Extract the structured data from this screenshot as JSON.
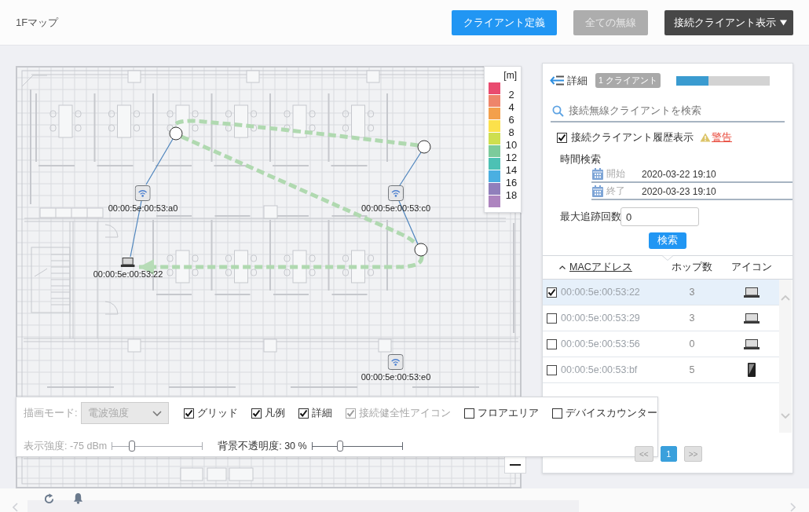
{
  "header": {
    "title": "1Fマップ",
    "buttons": [
      {
        "label": "クライアント定義",
        "kind": "primary",
        "disabled": false
      },
      {
        "label": "全ての無線",
        "kind": "plain",
        "disabled": true
      },
      {
        "label": "接続クライアント表示",
        "kind": "dropdown",
        "disabled": false
      }
    ]
  },
  "map": {
    "legend": {
      "unit": "[m]",
      "swatches": [
        {
          "color": "#e94b6f"
        },
        {
          "color": "#ee856a"
        },
        {
          "color": "#f3a04c"
        },
        {
          "color": "#fce14b"
        },
        {
          "color": "#cedf4f"
        },
        {
          "color": "#7ccb9b"
        },
        {
          "color": "#4dc1b4"
        },
        {
          "color": "#4bafe1"
        },
        {
          "color": "#907fbb"
        },
        {
          "color": "#ad84bf"
        }
      ],
      "labels": [
        "2",
        "4",
        "6",
        "8",
        "10",
        "12",
        "14",
        "16",
        "18"
      ]
    },
    "access_points": [
      {
        "label": "00:00:5e:00:53:a0"
      },
      {
        "label": "00:00:5e:00:53:c0"
      },
      {
        "label": "00:00:5e:00:53:e0"
      }
    ],
    "clients": [
      {
        "label": "00:00:5e:00:53:22",
        "kind": "laptop"
      }
    ]
  },
  "details": {
    "title": "詳細",
    "badge": "1 クライアント",
    "progress": {
      "level": 0.35
    },
    "search": {
      "placeholder": "接続無線クライアントを検索"
    },
    "history": {
      "label": "接続クライアント履歴表示",
      "checked": true,
      "warning": "警告"
    },
    "time_search": {
      "label": "時間検索",
      "fields": [
        {
          "label": "開始",
          "value": "2020-03-22 19:10"
        },
        {
          "label": "終了",
          "value": "2020-03-23 19:10"
        }
      ]
    },
    "max_trace": {
      "label": "最大追跡回数",
      "value": "0"
    },
    "search_button": "検索",
    "table": {
      "columns": [
        {
          "label": "MACアドレス",
          "sorted": true
        },
        {
          "label": "ホップ数",
          "sorted": false
        },
        {
          "label": "アイコン",
          "sorted": false
        }
      ],
      "rows": [
        {
          "checked": true,
          "selected": true,
          "mac": "00:00:5e:00:53:22",
          "hops": "3",
          "kind": "laptop"
        },
        {
          "checked": false,
          "selected": false,
          "mac": "00:00:5e:00:53:29",
          "hops": "3",
          "kind": "laptop"
        },
        {
          "checked": false,
          "selected": false,
          "mac": "00:00:5e:00:53:56",
          "hops": "0",
          "kind": "laptop"
        },
        {
          "checked": false,
          "selected": false,
          "mac": "00:00:5e:00:53:bf",
          "hops": "5",
          "kind": "phone"
        }
      ]
    },
    "pagination": {
      "prev": {
        "label": "<<",
        "disabled": true
      },
      "pages": [
        {
          "label": "1",
          "selected": true
        }
      ],
      "next": {
        "label": ">>",
        "disabled": true
      }
    }
  },
  "controls": {
    "mode": {
      "label": "描画モード:",
      "value": "電波強度",
      "disabled": true
    },
    "options": [
      {
        "label": "グリッド",
        "checked": true,
        "disabled": false
      },
      {
        "label": "凡例",
        "checked": true,
        "disabled": false
      },
      {
        "label": "詳細",
        "checked": true,
        "disabled": false
      },
      {
        "label": "接続健全性アイコン",
        "checked": true,
        "disabled": true
      },
      {
        "label": "フロアエリア",
        "checked": false,
        "disabled": false
      },
      {
        "label": "デバイスカウンター",
        "checked": false,
        "disabled": false
      }
    ],
    "sliders": [
      {
        "label": "表示強度: -75 dBm",
        "level": 0.22,
        "disabled": true
      },
      {
        "label": "背景不透明度: 30 %",
        "level": 0.31,
        "disabled": false
      }
    ]
  }
}
